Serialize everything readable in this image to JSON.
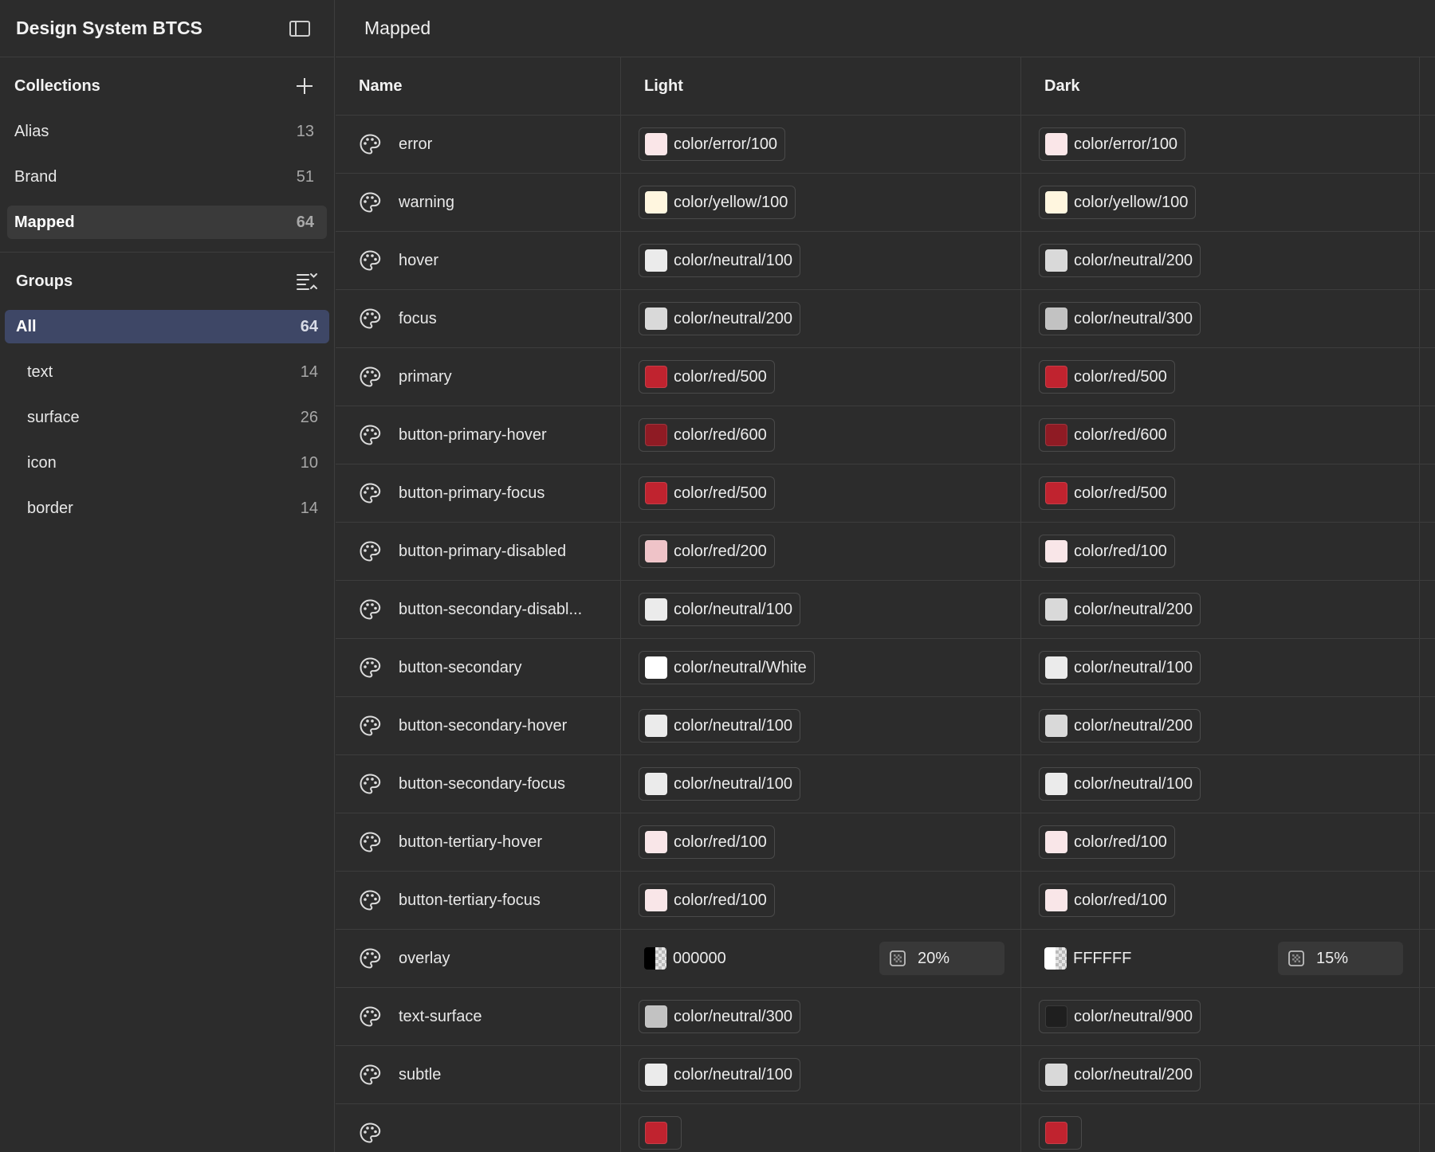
{
  "sidebar": {
    "title": "Design System BTCS",
    "collections_title": "Collections",
    "collections": [
      {
        "label": "Alias",
        "count": "13"
      },
      {
        "label": "Brand",
        "count": "51"
      },
      {
        "label": "Mapped",
        "count": "64"
      }
    ],
    "groups_title": "Groups",
    "groups": [
      {
        "label": "All",
        "count": "64"
      },
      {
        "label": "text",
        "count": "14"
      },
      {
        "label": "surface",
        "count": "26"
      },
      {
        "label": "icon",
        "count": "10"
      },
      {
        "label": "border",
        "count": "14"
      }
    ]
  },
  "main": {
    "title": "Mapped",
    "columns": {
      "name": "Name",
      "light": "Light",
      "dark": "Dark"
    }
  },
  "colors": {
    "error100": "#fae6e8",
    "yellow100": "#fff6df",
    "neutral100": "#ebebeb",
    "neutral200": "#d9d9d9",
    "neutral300": "#c2c2c2",
    "neutral900": "#1f1f1f",
    "white": "#ffffff",
    "red100": "#f9e6e8",
    "red200": "#efc3c8",
    "red500": "#c0232f",
    "red600": "#8f1b24",
    "group_active_bg": "#3e4766"
  },
  "rows": [
    {
      "name": "error",
      "light": {
        "label": "color/error/100",
        "swatch": "#fae6e8"
      },
      "dark": {
        "label": "color/error/100",
        "swatch": "#fae6e8"
      }
    },
    {
      "name": "warning",
      "light": {
        "label": "color/yellow/100",
        "swatch": "#fff6df"
      },
      "dark": {
        "label": "color/yellow/100",
        "swatch": "#fff6df"
      }
    },
    {
      "name": "hover",
      "light": {
        "label": "color/neutral/100",
        "swatch": "#ebebeb"
      },
      "dark": {
        "label": "color/neutral/200",
        "swatch": "#d9d9d9"
      }
    },
    {
      "name": "focus",
      "light": {
        "label": "color/neutral/200",
        "swatch": "#d9d9d9"
      },
      "dark": {
        "label": "color/neutral/300",
        "swatch": "#c2c2c2"
      }
    },
    {
      "name": "primary",
      "light": {
        "label": "color/red/500",
        "swatch": "#c0232f"
      },
      "dark": {
        "label": "color/red/500",
        "swatch": "#c0232f"
      }
    },
    {
      "name": "button-primary-hover",
      "light": {
        "label": "color/red/600",
        "swatch": "#8f1b24"
      },
      "dark": {
        "label": "color/red/600",
        "swatch": "#8f1b24"
      }
    },
    {
      "name": "button-primary-focus",
      "light": {
        "label": "color/red/500",
        "swatch": "#c0232f"
      },
      "dark": {
        "label": "color/red/500",
        "swatch": "#c0232f"
      }
    },
    {
      "name": "button-primary-disabled",
      "light": {
        "label": "color/red/200",
        "swatch": "#efc3c8"
      },
      "dark": {
        "label": "color/red/100",
        "swatch": "#f9e6e8"
      }
    },
    {
      "name": "button-secondary-disabl...",
      "light": {
        "label": "color/neutral/100",
        "swatch": "#ebebeb"
      },
      "dark": {
        "label": "color/neutral/200",
        "swatch": "#d9d9d9"
      }
    },
    {
      "name": "button-secondary",
      "light": {
        "label": "color/neutral/White",
        "swatch": "#ffffff"
      },
      "dark": {
        "label": "color/neutral/100",
        "swatch": "#ebebeb"
      }
    },
    {
      "name": "button-secondary-hover",
      "light": {
        "label": "color/neutral/100",
        "swatch": "#ebebeb"
      },
      "dark": {
        "label": "color/neutral/200",
        "swatch": "#d9d9d9"
      }
    },
    {
      "name": "button-secondary-focus",
      "light": {
        "label": "color/neutral/100",
        "swatch": "#ebebeb"
      },
      "dark": {
        "label": "color/neutral/100",
        "swatch": "#ebebeb"
      }
    },
    {
      "name": "button-tertiary-hover",
      "light": {
        "label": "color/red/100",
        "swatch": "#f9e6e8"
      },
      "dark": {
        "label": "color/red/100",
        "swatch": "#f9e6e8"
      }
    },
    {
      "name": "button-tertiary-focus",
      "light": {
        "label": "color/red/100",
        "swatch": "#f9e6e8"
      },
      "dark": {
        "label": "color/red/100",
        "swatch": "#f9e6e8"
      }
    },
    {
      "name": "overlay",
      "light": {
        "hex": "000000",
        "hex_color": "#000000",
        "opacity": "20%"
      },
      "dark": {
        "hex": "FFFFFF",
        "hex_color": "#ffffff",
        "opacity": "15%"
      }
    },
    {
      "name": "text-surface",
      "light": {
        "label": "color/neutral/300",
        "swatch": "#c2c2c2"
      },
      "dark": {
        "label": "color/neutral/900",
        "swatch": "#1f1f1f"
      }
    },
    {
      "name": "subtle",
      "light": {
        "label": "color/neutral/100",
        "swatch": "#ebebeb"
      },
      "dark": {
        "label": "color/neutral/200",
        "swatch": "#d9d9d9"
      }
    },
    {
      "name": "",
      "light": {
        "label": "",
        "swatch": "#c0232f"
      },
      "dark": {
        "label": "",
        "swatch": "#c0232f"
      }
    }
  ],
  "icons": {
    "panel_toggle": "sidebar-toggle-icon",
    "add": "plus-icon",
    "groups_sort": "sort-list-icon",
    "row": "palette-icon",
    "opacity": "opacity-grid-icon"
  }
}
